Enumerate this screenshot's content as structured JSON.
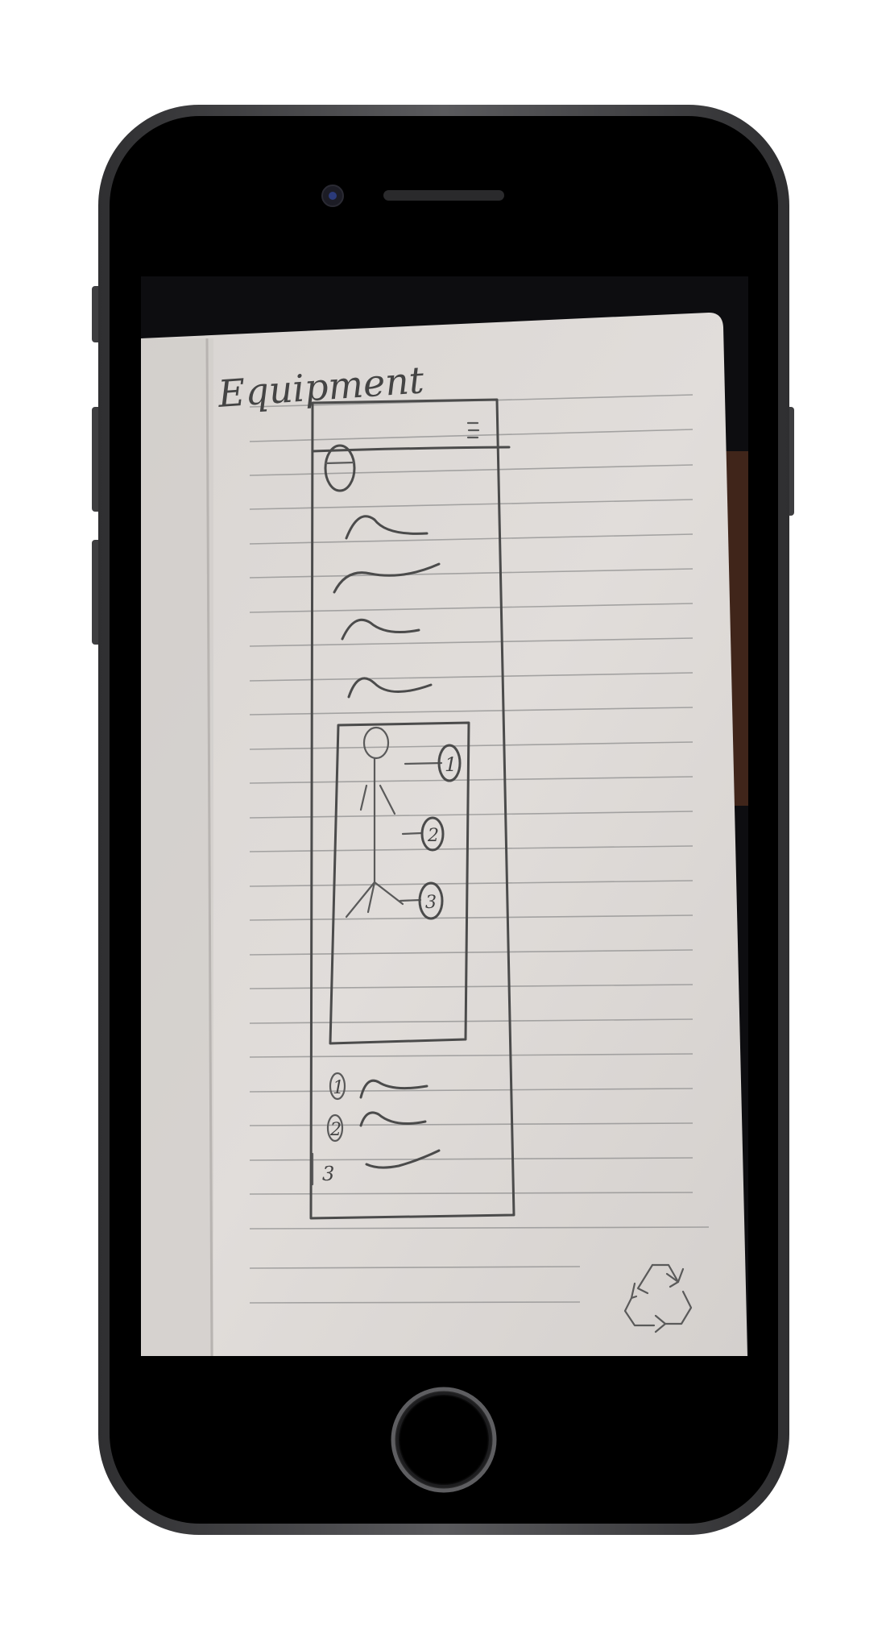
{
  "device": {
    "type": "smartphone",
    "frame_color": "#4a4a4c",
    "screen_background": "#000000"
  },
  "photo": {
    "subject": "notebook page with a pencil wireframe sketch",
    "paper_color": "#dedad6"
  },
  "sketch": {
    "title": "Equipment",
    "menu_icon": "hamburger-icon",
    "header_avatar": "circle-avatar-icon",
    "text_lines_count": 4,
    "diagram": {
      "figure": "stick-figure",
      "callouts": [
        "1",
        "2",
        "3"
      ]
    },
    "legend": [
      {
        "number": "1"
      },
      {
        "number": "2"
      },
      {
        "number": "3"
      }
    ],
    "corner_icon": "recycle-icon"
  }
}
